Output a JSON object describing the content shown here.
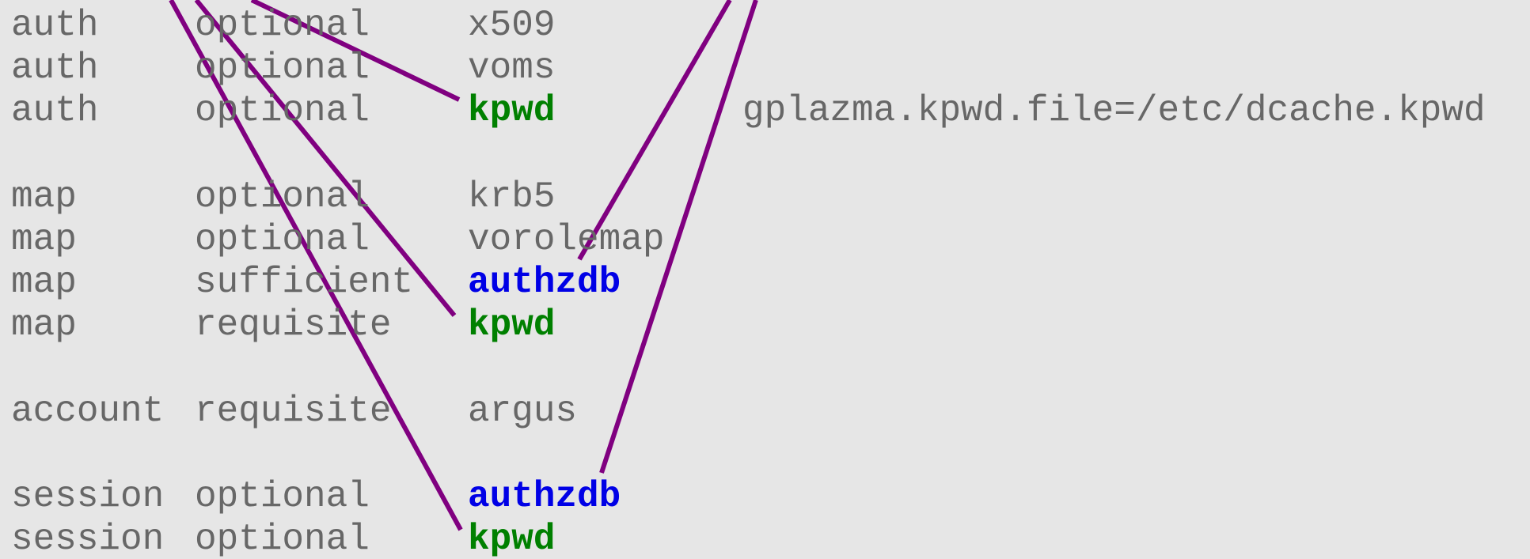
{
  "config": {
    "rows": [
      {
        "type": "auth",
        "control": "optional",
        "module": "x509",
        "option": "",
        "color": "#676767",
        "bold": false
      },
      {
        "type": "auth",
        "control": "optional",
        "module": "voms",
        "option": "",
        "color": "#676767",
        "bold": false
      },
      {
        "type": "auth",
        "control": "optional",
        "module": "kpwd",
        "option": "gplazma.kpwd.file=/etc/dcache.kpwd",
        "color": "#008000",
        "bold": true
      },
      {
        "type": "map",
        "control": "optional",
        "module": "krb5",
        "option": "",
        "color": "#676767",
        "bold": false
      },
      {
        "type": "map",
        "control": "optional",
        "module": "vorolemap",
        "option": "",
        "color": "#676767",
        "bold": false
      },
      {
        "type": "map",
        "control": "sufficient",
        "module": "authzdb",
        "option": "",
        "color": "#0000e6",
        "bold": true
      },
      {
        "type": "map",
        "control": "requisite",
        "module": "kpwd",
        "option": "",
        "color": "#008000",
        "bold": true
      },
      {
        "type": "account",
        "control": "requisite",
        "module": "argus",
        "option": "",
        "color": "#676767",
        "bold": false
      },
      {
        "type": "session",
        "control": "optional",
        "module": "authzdb",
        "option": "",
        "color": "#0000e6",
        "bold": true
      },
      {
        "type": "session",
        "control": "optional",
        "module": "kpwd",
        "option": "",
        "color": "#008000",
        "bold": true
      }
    ]
  },
  "connectors": {
    "color": "#800080",
    "links": [
      {
        "from": "offscreen-kpwd-source",
        "to_row": 2
      },
      {
        "from": "offscreen-kpwd-source",
        "to_row": 6
      },
      {
        "from": "offscreen-kpwd-source",
        "to_row": 9
      },
      {
        "from": "offscreen-authzdb-source",
        "to_row": 4
      },
      {
        "from": "offscreen-authzdb-source",
        "to_row": 8
      }
    ]
  }
}
